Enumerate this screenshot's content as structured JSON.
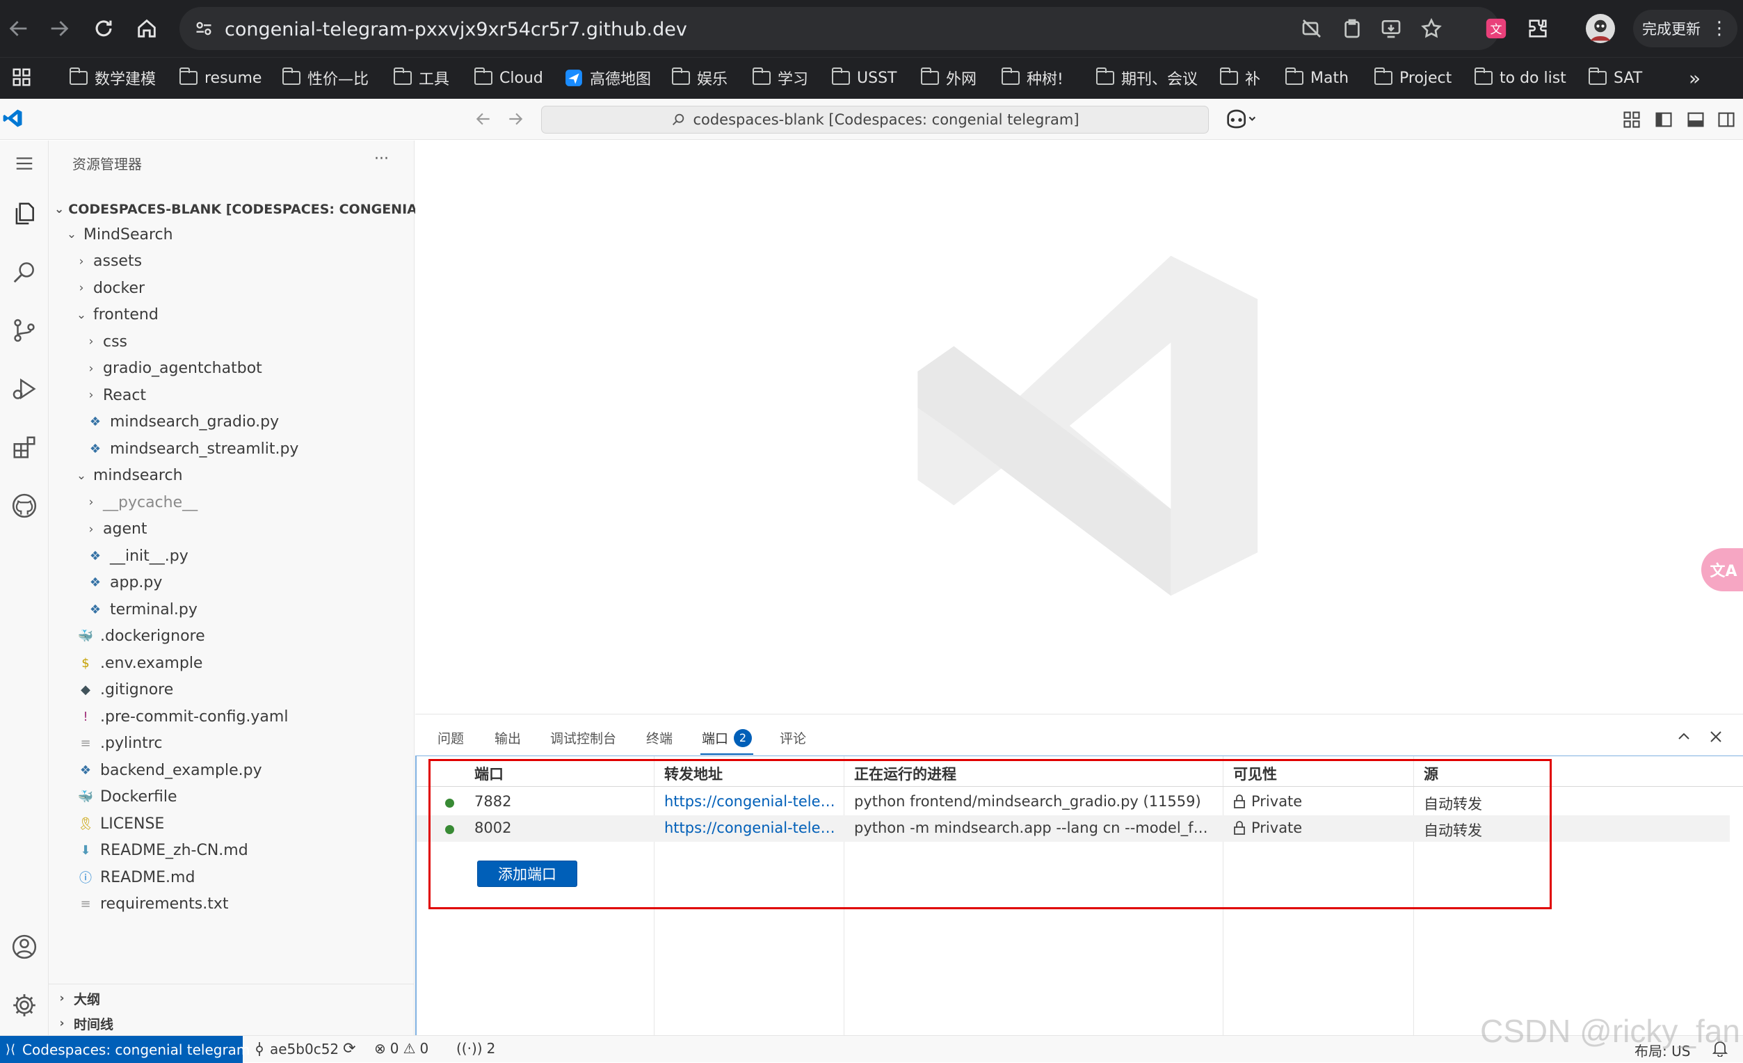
{
  "browser": {
    "url": "congenial-telegram-pxxvjx9xr54cr5r7.github.dev",
    "update_label": "完成更新",
    "bookmarks": [
      {
        "label": "数学建模"
      },
      {
        "label": "resume"
      },
      {
        "label": "性价—比"
      },
      {
        "label": "工具"
      },
      {
        "label": "Cloud"
      },
      {
        "label": "高德地图"
      },
      {
        "label": "娱乐"
      },
      {
        "label": "学习"
      },
      {
        "label": "USST"
      },
      {
        "label": "外网"
      },
      {
        "label": "种树!"
      },
      {
        "label": "期刊、会议"
      },
      {
        "label": "补"
      },
      {
        "label": "Math"
      },
      {
        "label": "Project"
      },
      {
        "label": "to do list"
      },
      {
        "label": "SAT"
      }
    ]
  },
  "titlebar": {
    "command_center": "codespaces-blank [Codespaces: congenial telegram]"
  },
  "sidebar": {
    "title": "资源管理器",
    "more": "···",
    "workspace": "CODESPACES-BLANK [CODESPACES: CONGENIAL TE...",
    "tree": [
      {
        "label": "MindSearch",
        "chev": "⌄",
        "icon": ""
      },
      {
        "label": "assets",
        "chev": "›",
        "icon": ""
      },
      {
        "label": "docker",
        "chev": "›",
        "icon": ""
      },
      {
        "label": "frontend",
        "chev": "⌄",
        "icon": ""
      },
      {
        "label": "css",
        "chev": "›",
        "icon": ""
      },
      {
        "label": "gradio_agentchatbot",
        "chev": "›",
        "icon": ""
      },
      {
        "label": "React",
        "chev": "›",
        "icon": ""
      },
      {
        "label": "mindsearch_gradio.py",
        "chev": "",
        "icon": "py"
      },
      {
        "label": "mindsearch_streamlit.py",
        "chev": "",
        "icon": "py"
      },
      {
        "label": "mindsearch",
        "chev": "⌄",
        "icon": ""
      },
      {
        "label": "__pycache__",
        "chev": "›",
        "icon": ""
      },
      {
        "label": "agent",
        "chev": "›",
        "icon": ""
      },
      {
        "label": "__init__.py",
        "chev": "",
        "icon": "py"
      },
      {
        "label": "app.py",
        "chev": "",
        "icon": "py"
      },
      {
        "label": "terminal.py",
        "chev": "",
        "icon": "py"
      },
      {
        "label": ".dockerignore",
        "chev": "",
        "icon": "docker"
      },
      {
        "label": ".env.example",
        "chev": "",
        "icon": "env"
      },
      {
        "label": ".gitignore",
        "chev": "",
        "icon": "git"
      },
      {
        "label": ".pre-commit-config.yaml",
        "chev": "",
        "icon": "yaml"
      },
      {
        "label": ".pylintrc",
        "chev": "",
        "icon": "text"
      },
      {
        "label": "backend_example.py",
        "chev": "",
        "icon": "py"
      },
      {
        "label": "Dockerfile",
        "chev": "",
        "icon": "docker"
      },
      {
        "label": "LICENSE",
        "chev": "",
        "icon": "license"
      },
      {
        "label": "README_zh-CN.md",
        "chev": "",
        "icon": "md"
      },
      {
        "label": "README.md",
        "chev": "",
        "icon": "info"
      },
      {
        "label": "requirements.txt",
        "chev": "",
        "icon": "text"
      }
    ],
    "outline": "大纲",
    "timeline": "时间线"
  },
  "panel": {
    "tabs": [
      {
        "label": "问题"
      },
      {
        "label": "输出"
      },
      {
        "label": "调试控制台"
      },
      {
        "label": "终端"
      },
      {
        "label": "端口"
      },
      {
        "label": "评论"
      }
    ],
    "ports_badge": "2",
    "headers": {
      "port": "端口",
      "forwarded": "转发地址",
      "process": "正在运行的进程",
      "visibility": "可见性",
      "origin": "源"
    },
    "rows": [
      {
        "port": "7882",
        "address": "https://congenial-teleg...",
        "process": "python frontend/mindsearch_gradio.py (11559)",
        "visibility": "Private",
        "origin": "自动转发"
      },
      {
        "port": "8002",
        "address": "https://congenial-teleg...",
        "process": "python -m mindsearch.app --lang cn --model_for...",
        "visibility": "Private",
        "origin": "自动转发"
      }
    ],
    "add_port": "添加端口"
  },
  "status": {
    "remote": "Codespaces: congenial telegram",
    "branch": "ae5b0c52",
    "errors": "0",
    "warnings": "0",
    "ports": "2",
    "layout": "布局: US"
  },
  "watermark": "CSDN @ricky_fan",
  "colors": {
    "accent": "#005fb8",
    "highlight_box": "#e00000",
    "chrome": "#202124",
    "running": "#388a34"
  }
}
